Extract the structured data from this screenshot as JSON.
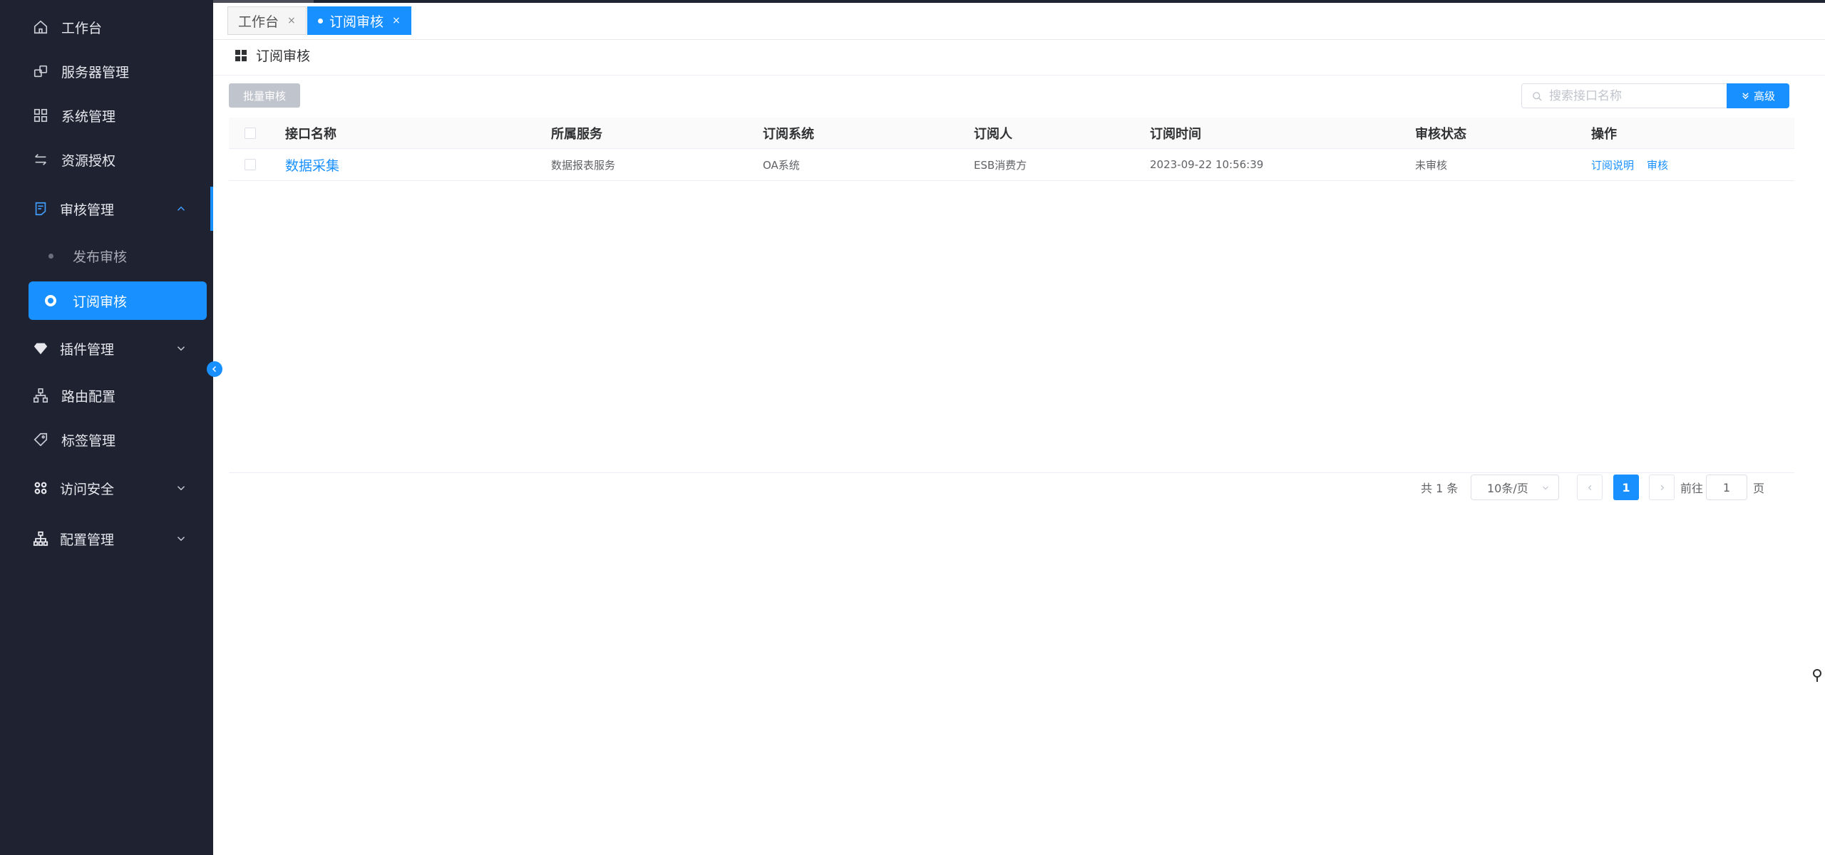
{
  "sidebar": {
    "items": [
      {
        "label": "工作台",
        "icon": "home-icon"
      },
      {
        "label": "服务器管理",
        "icon": "server-icon"
      },
      {
        "label": "系统管理",
        "icon": "grid-icon"
      },
      {
        "label": "资源授权",
        "icon": "transfer-icon"
      },
      {
        "label": "审核管理",
        "icon": "audit-icon",
        "expanded": true
      },
      {
        "label": "插件管理",
        "icon": "diamond-icon",
        "expanded": false
      },
      {
        "label": "路由配置",
        "icon": "route-icon"
      },
      {
        "label": "标签管理",
        "icon": "tag-icon"
      },
      {
        "label": "访问安全",
        "icon": "apps-icon",
        "expanded": false
      },
      {
        "label": "配置管理",
        "icon": "org-icon",
        "expanded": false
      }
    ],
    "sub_items": [
      {
        "label": "发布审核",
        "selected": false
      },
      {
        "label": "订阅审核",
        "selected": true
      }
    ]
  },
  "tabs": [
    {
      "label": "工作台",
      "close": "×",
      "active": false
    },
    {
      "label": "订阅审核",
      "close": "×",
      "active": true
    }
  ],
  "page": {
    "title": "订阅审核"
  },
  "toolbar": {
    "batch_label": "批量审核",
    "search_placeholder": "搜索接口名称",
    "search_value": "",
    "advanced_label": "高级"
  },
  "table": {
    "columns": [
      "接口名称",
      "所属服务",
      "订阅系统",
      "订阅人",
      "订阅时间",
      "审核状态",
      "操作"
    ],
    "rows": [
      {
        "name": "数据采集",
        "service": "数据报表服务",
        "system": "OA系统",
        "subscriber": "ESB消费方",
        "time": "2023-09-22 10:56:39",
        "status": "未审核",
        "actions": [
          "订阅说明",
          "审核"
        ]
      }
    ]
  },
  "pagination": {
    "total_text": "共 1 条",
    "page_size": "10条/页",
    "current_page": "1",
    "goto_label": "前往",
    "goto_value": "1",
    "page_suffix": "页"
  },
  "colors": {
    "sidebar_bg": "#1f2230",
    "primary": "#1890ff",
    "disabled_button": "#c0c4cc"
  }
}
